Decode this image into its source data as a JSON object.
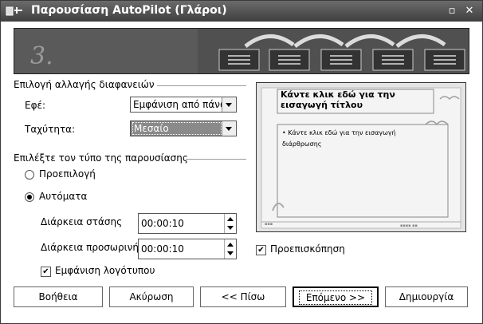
{
  "window": {
    "title": "Παρουσίαση AutoPilot (Γλάροι)"
  },
  "banner": {
    "step": "3."
  },
  "transition_section": {
    "heading": "Επιλογή αλλαγής διαφανειών",
    "effect_label": "Εφέ:",
    "effect_value": "Εμφάνιση από πάνω",
    "speed_label": "Ταχύτητα:",
    "speed_value": "Μεσαίο"
  },
  "presentation_section": {
    "heading": "Επιλέξτε τον τύπο της παρουσίασης",
    "option_default": "Προεπιλογή",
    "option_auto": "Αυτόματα",
    "duration_page_label": "Διάρκεια στάσης",
    "duration_page_value": "00:00:10",
    "duration_pause_label": "Διάρκεια προσωρινής",
    "duration_pause_value": "00:00:10",
    "show_logo_label": "Εμφάνιση λογότυπου"
  },
  "preview": {
    "title_text": "Κάντε κλικ εδώ για την εισαγωγή τίτλου",
    "body_text": "Κάντε κλικ εδώ για την εισαγωγή διάρθρωσης",
    "checkbox_label": "Προεπισκόπηση"
  },
  "buttons": {
    "help": "Βοήθεια",
    "cancel": "Ακύρωση",
    "back": "<< Πίσω",
    "next": "Επόμενο >>",
    "create": "Δημιουργία"
  }
}
